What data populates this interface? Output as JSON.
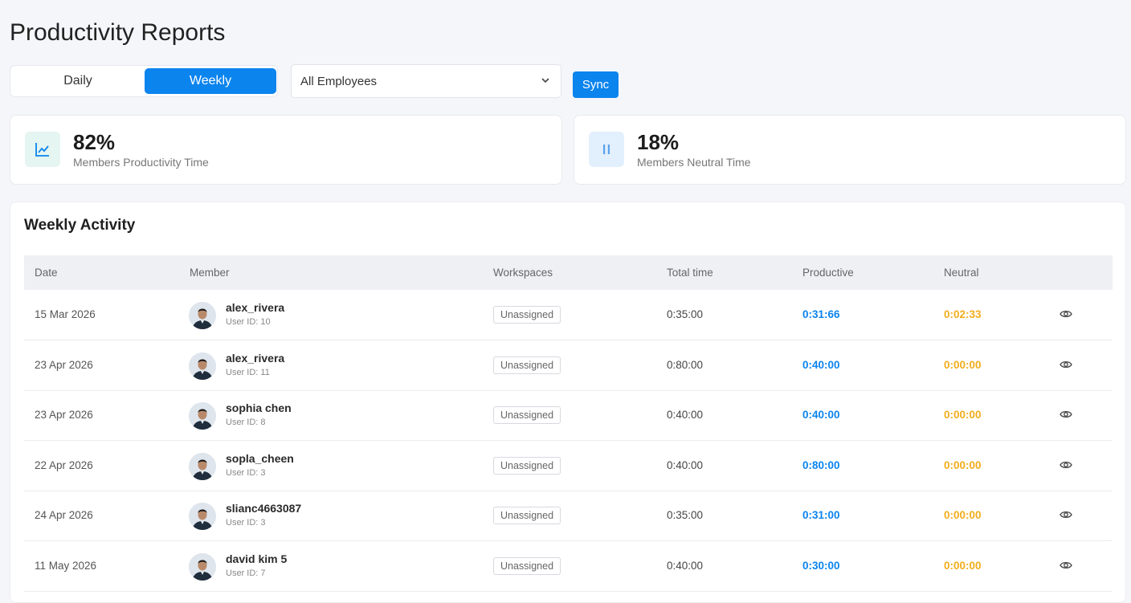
{
  "page": {
    "title": "Productivity Reports"
  },
  "filters": {
    "daily_label": "Daily",
    "weekly_label": "Weekly",
    "employee_select": "All Employees",
    "sync_label": "Sync"
  },
  "stats": [
    {
      "value": "82%",
      "label": "Members Productivity Time",
      "icon": "line-chart-icon"
    },
    {
      "value": "18%",
      "label": "Members Neutral Time",
      "icon": "pause-icon"
    }
  ],
  "activity": {
    "title": "Weekly Activity",
    "columns": {
      "date": "Date",
      "member": "Member",
      "workspaces": "Workspaces",
      "total": "Total time",
      "productive": "Productive",
      "neutral": "Neutral"
    },
    "rows": [
      {
        "date": "15 Mar 2026",
        "name": "alex_rivera",
        "uid": "User ID: 10",
        "workspace": "Unassigned",
        "total": "0:35:00",
        "productive": "0:31:66",
        "neutral": "0:02:33"
      },
      {
        "date": "23 Apr 2026",
        "name": "alex_rivera",
        "uid": "User ID: 11",
        "workspace": "Unassigned",
        "total": "0:80:00",
        "productive": "0:40:00",
        "neutral": "0:00:00"
      },
      {
        "date": "23 Apr 2026",
        "name": "sophia chen",
        "uid": "User ID: 8",
        "workspace": "Unassigned",
        "total": "0:40:00",
        "productive": "0:40:00",
        "neutral": "0:00:00"
      },
      {
        "date": "22 Apr 2026",
        "name": "sopla_cheen",
        "uid": "User ID: 3",
        "workspace": "Unassigned",
        "total": "0:40:00",
        "productive": "0:80:00",
        "neutral": "0:00:00"
      },
      {
        "date": "24 Apr 2026",
        "name": "slianc4663087",
        "uid": "User ID: 3",
        "workspace": "Unassigned",
        "total": "0:35:00",
        "productive": "0:31:00",
        "neutral": "0:00:00"
      },
      {
        "date": "11 May 2026",
        "name": "david kim 5",
        "uid": "User ID: 7",
        "workspace": "Unassigned",
        "total": "0:40:00",
        "productive": "0:30:00",
        "neutral": "0:00:00"
      }
    ]
  },
  "colors": {
    "accent": "#0b84ee",
    "neutral": "#f2ad1d"
  }
}
